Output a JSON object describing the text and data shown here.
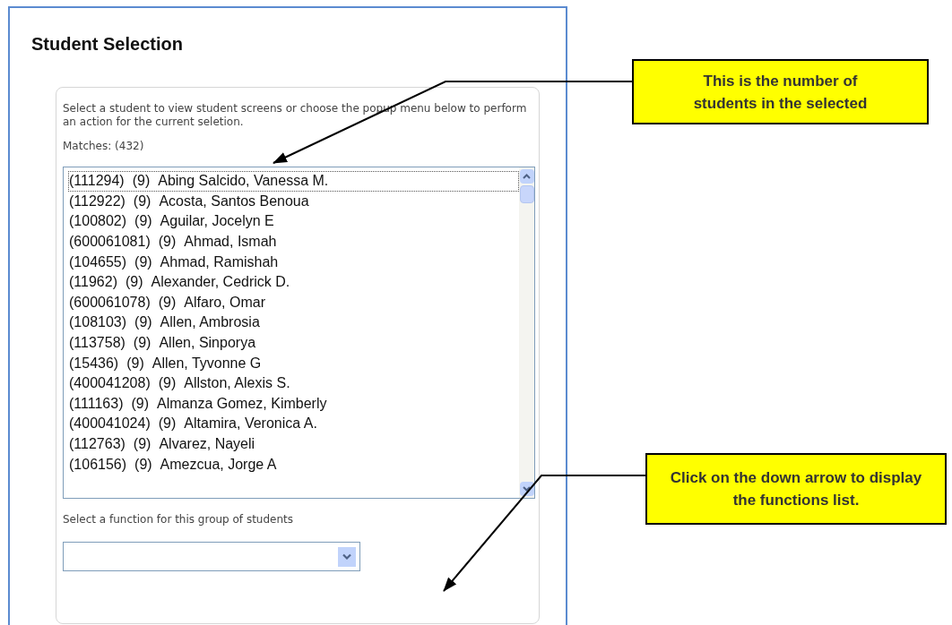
{
  "panel": {
    "title": "Student Selection"
  },
  "card": {
    "instructions": "Select a student to view student screens or choose the popup menu below to perform an action for the current seletion.",
    "matches": "Matches: (432)"
  },
  "students": [
    {
      "id": "(111294)",
      "grade": "(9)",
      "name": "Abing Salcido, Vanessa M.",
      "selected": true
    },
    {
      "id": "(112922)",
      "grade": "(9)",
      "name": "Acosta, Santos Benoua",
      "selected": false
    },
    {
      "id": "(100802)",
      "grade": "(9)",
      "name": "Aguilar, Jocelyn E",
      "selected": false
    },
    {
      "id": "(600061081)",
      "grade": "(9)",
      "name": "Ahmad, Ismah",
      "selected": false
    },
    {
      "id": "(104655)",
      "grade": "(9)",
      "name": "Ahmad, Ramishah",
      "selected": false
    },
    {
      "id": "(11962)",
      "grade": "(9)",
      "name": "Alexander, Cedrick D.",
      "selected": false
    },
    {
      "id": "(600061078)",
      "grade": "(9)",
      "name": "Alfaro, Omar",
      "selected": false
    },
    {
      "id": "(108103)",
      "grade": "(9)",
      "name": "Allen, Ambrosia",
      "selected": false
    },
    {
      "id": "(113758)",
      "grade": "(9)",
      "name": "Allen, Sinporya",
      "selected": false
    },
    {
      "id": "(15436)",
      "grade": "(9)",
      "name": "Allen, Tyvonne G",
      "selected": false
    },
    {
      "id": "(400041208)",
      "grade": "(9)",
      "name": "Allston, Alexis S.",
      "selected": false
    },
    {
      "id": "(111163)",
      "grade": "(9)",
      "name": "Almanza Gomez, Kimberly",
      "selected": false
    },
    {
      "id": "(400041024)",
      "grade": "(9)",
      "name": "Altamira, Veronica A.",
      "selected": false
    },
    {
      "id": "(112763)",
      "grade": "(9)",
      "name": "Alvarez, Nayeli",
      "selected": false
    },
    {
      "id": "(106156)",
      "grade": "(9)",
      "name": "Amezcua, Jorge A",
      "selected": false
    }
  ],
  "function_select": {
    "label": "Select a function for this group of students"
  },
  "callouts": [
    {
      "text": "This is the number of students in the selected"
    },
    {
      "text": "Click on the down arrow to display the functions list."
    }
  ]
}
